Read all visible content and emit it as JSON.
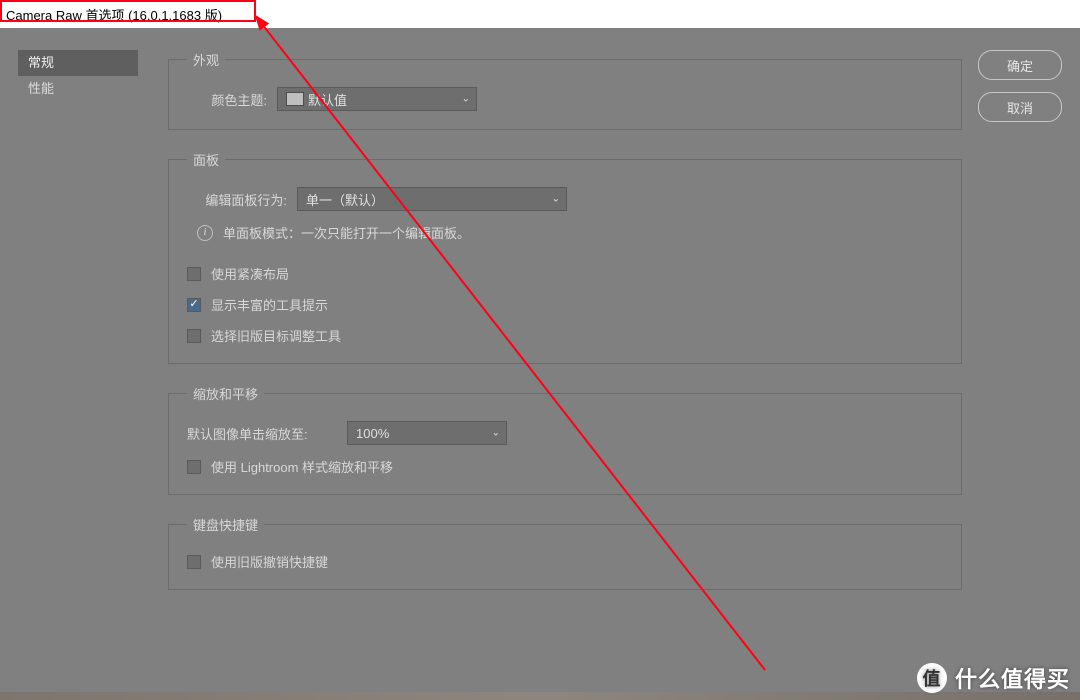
{
  "window": {
    "title": "Camera Raw 首选项  (16.0.1.1683 版)"
  },
  "sidebar": {
    "items": [
      {
        "label": "常规",
        "active": true
      },
      {
        "label": "性能",
        "active": false
      }
    ]
  },
  "buttons": {
    "ok": "确定",
    "cancel": "取消"
  },
  "sections": {
    "appearance": {
      "legend": "外观",
      "color_theme_label": "颜色主题:",
      "color_theme_value": "默认值"
    },
    "panel": {
      "legend": "面板",
      "edit_behavior_label": "编辑面板行为:",
      "edit_behavior_value": "单一（默认）",
      "single_mode_note": "单面板模式：一次只能打开一个编辑面板。",
      "compact_layout": {
        "label": "使用紧凑布局",
        "checked": false
      },
      "rich_tooltips": {
        "label": "显示丰富的工具提示",
        "checked": true
      },
      "legacy_target": {
        "label": "选择旧版目标调整工具",
        "checked": false
      }
    },
    "zoom": {
      "legend": "缩放和平移",
      "default_zoom_label": "默认图像单击缩放至:",
      "default_zoom_value": "100%",
      "lightroom_zoom": {
        "label": "使用 Lightroom 样式缩放和平移",
        "checked": false
      }
    },
    "keyboard": {
      "legend": "键盘快捷键",
      "legacy_undo": {
        "label": "使用旧版撤销快捷键",
        "checked": false
      }
    }
  },
  "watermark": {
    "badge": "值",
    "text": "什么值得买"
  }
}
